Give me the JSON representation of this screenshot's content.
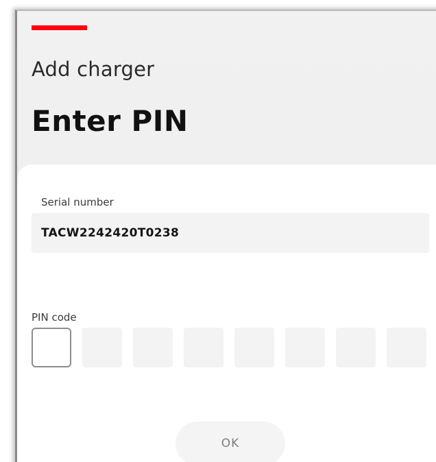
{
  "header": {
    "overline": "Add charger",
    "title": "Enter PIN",
    "accent_color": "#ff000f"
  },
  "serial": {
    "label": "Serial number",
    "value": "TACW2242420T0238"
  },
  "pin": {
    "label": "PIN code",
    "boxes": [
      "",
      "",
      "",
      "",
      "",
      "",
      "",
      ""
    ]
  },
  "actions": {
    "ok_label": "OK"
  }
}
